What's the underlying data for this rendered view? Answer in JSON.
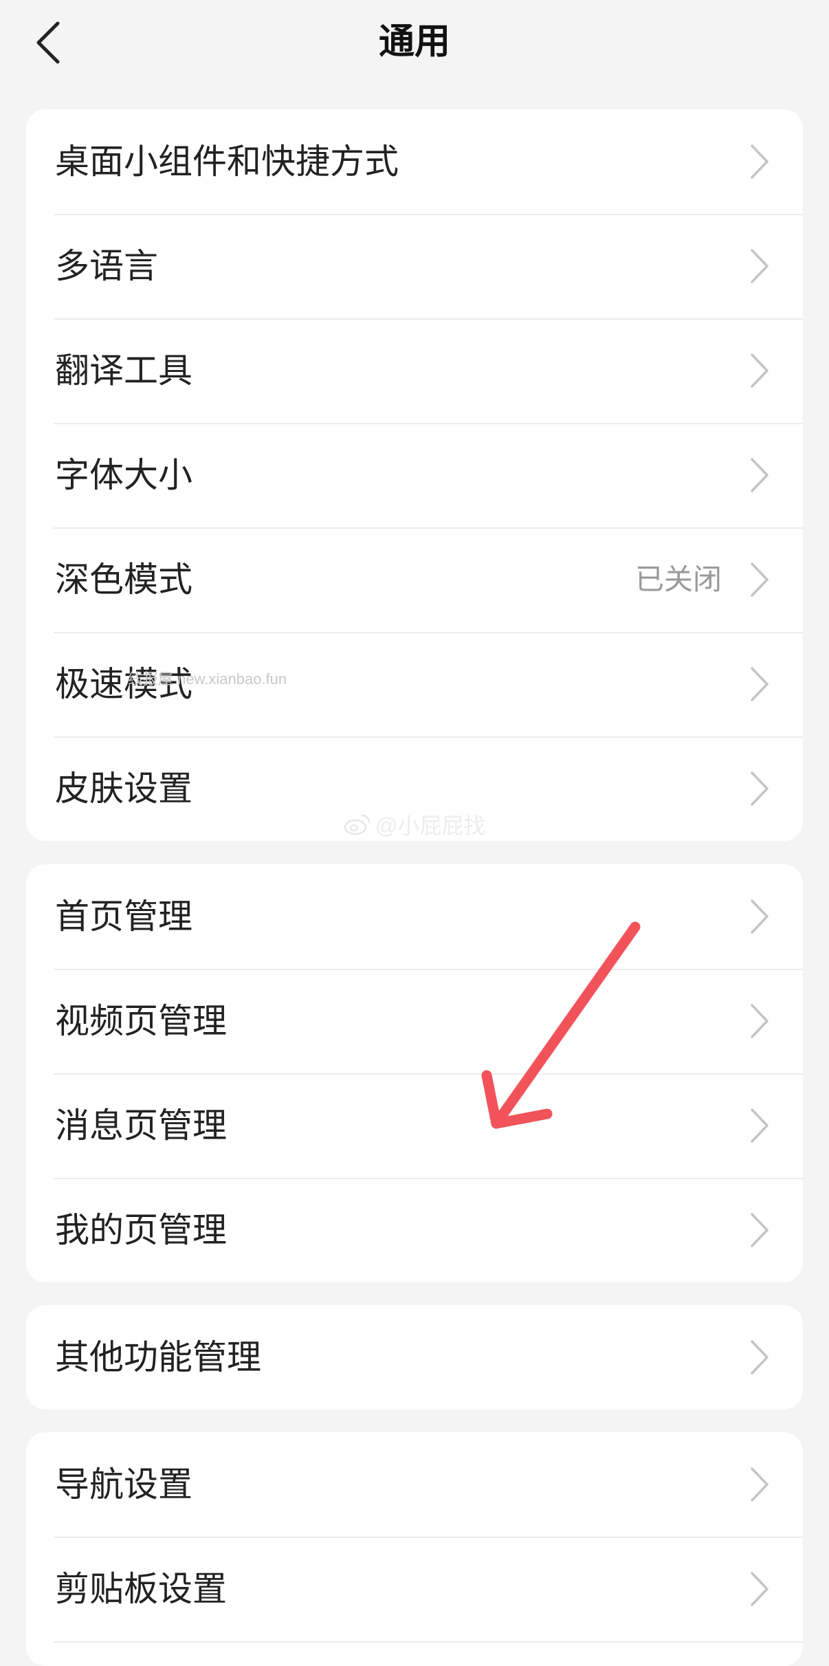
{
  "header": {
    "title": "通用"
  },
  "groups": [
    {
      "items": [
        {
          "label": "桌面小组件和快捷方式"
        },
        {
          "label": "多语言"
        },
        {
          "label": "翻译工具"
        },
        {
          "label": "字体大小"
        },
        {
          "label": "深色模式",
          "value": "已关闭"
        },
        {
          "label": "极速模式"
        },
        {
          "label": "皮肤设置"
        }
      ]
    },
    {
      "items": [
        {
          "label": "首页管理"
        },
        {
          "label": "视频页管理"
        },
        {
          "label": "消息页管理"
        },
        {
          "label": "我的页管理"
        }
      ]
    },
    {
      "items": [
        {
          "label": "其他功能管理"
        }
      ]
    },
    {
      "items": [
        {
          "label": "导航设置"
        },
        {
          "label": "剪贴板设置"
        }
      ]
    }
  ],
  "watermarks": {
    "url": "线报屋 new.xianbao.fun",
    "handle": "@小屁屁找"
  },
  "colors": {
    "background": "#f4f4f4",
    "card": "#ffffff",
    "divider": "#ececec",
    "text_primary": "#222222",
    "text_secondary": "#9a9a9a",
    "chevron": "#c4c4c4",
    "annotation_arrow": "#f2535b"
  },
  "icons": {
    "back": "chevron-left-icon",
    "row_action": "chevron-right-icon",
    "watermark_logo": "weibo-icon",
    "annotation": "red-arrow-annotation"
  }
}
